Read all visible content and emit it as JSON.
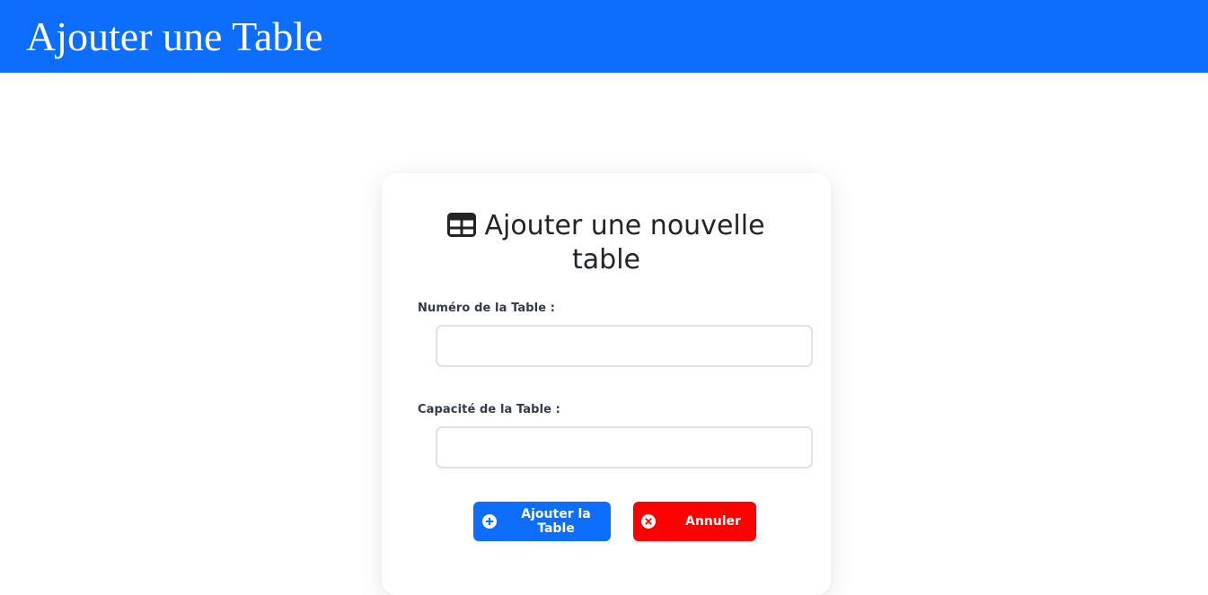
{
  "header": {
    "title": "Ajouter une Table",
    "color": "#0d6efd"
  },
  "form": {
    "title_line1": "Ajouter une nouvelle",
    "title_line2": "table",
    "title_icon": "table-icon",
    "fields": [
      {
        "label": "Numéro de la Table :",
        "value": "",
        "placeholder": ""
      },
      {
        "label": "Capacité de la Table :",
        "value": "",
        "placeholder": ""
      }
    ],
    "submit_label": "Ajouter la Table",
    "submit_icon": "plus-circle-icon",
    "submit_color": "#0d6efd",
    "cancel_label": "Annuler",
    "cancel_icon": "x-circle-icon",
    "cancel_color": "#ff0000"
  }
}
